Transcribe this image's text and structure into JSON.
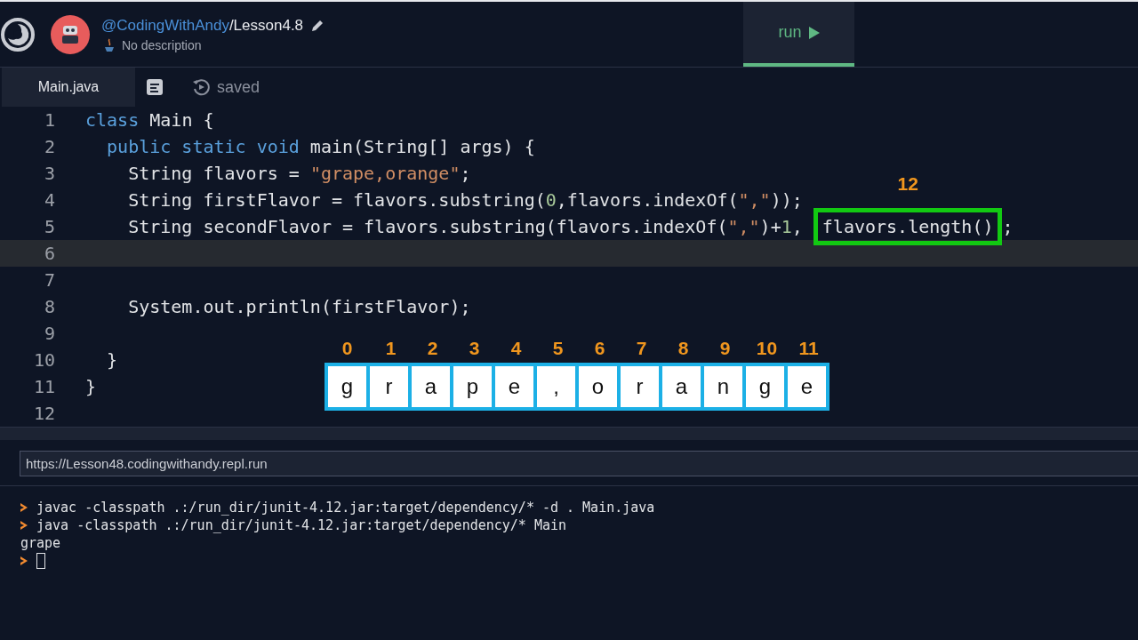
{
  "header": {
    "owner": "@CodingWithAndy",
    "title": "/Lesson4.8",
    "description": "No description"
  },
  "run_button": {
    "label": "run"
  },
  "file_tab": {
    "label": "Main.java",
    "selected": true
  },
  "save_status": "saved",
  "lines": [
    {
      "number": "1",
      "current": false,
      "tokens": [
        {
          "kind": "keyword",
          "text": "class"
        },
        {
          "kind": "plain",
          "text": " Main {"
        }
      ]
    },
    {
      "number": "2",
      "current": false,
      "tokens": [
        {
          "kind": "keyword",
          "text": "  public static void"
        },
        {
          "kind": "plain",
          "text": " main(String[] args) {"
        }
      ]
    },
    {
      "number": "3",
      "current": false,
      "tokens": [
        {
          "kind": "plain",
          "text": "    String flavors = "
        },
        {
          "kind": "string",
          "text": "\"grape,orange\""
        },
        {
          "kind": "plain",
          "text": ";"
        }
      ]
    },
    {
      "number": "4",
      "current": false,
      "tokens": [
        {
          "kind": "plain",
          "text": "    String firstFlavor = flavors.substring("
        },
        {
          "kind": "number",
          "text": "0"
        },
        {
          "kind": "plain",
          "text": ",flavors.indexOf("
        },
        {
          "kind": "string",
          "text": "\",\""
        },
        {
          "kind": "plain",
          "text": "));"
        }
      ]
    },
    {
      "number": "5",
      "current": false,
      "tokens": [
        {
          "kind": "plain",
          "text": "    String secondFlavor = flavors.substring(flavors.indexOf("
        },
        {
          "kind": "string",
          "text": "\",\""
        },
        {
          "kind": "plain",
          "text": ")+"
        },
        {
          "kind": "number",
          "text": "1"
        },
        {
          "kind": "plain",
          "text": ", "
        },
        {
          "kind": "boxed",
          "text": "flavors.length()",
          "callout": "12"
        },
        {
          "kind": "plain",
          "text": ";"
        }
      ]
    },
    {
      "number": "6",
      "current": true
    },
    {
      "number": "7",
      "current": false
    },
    {
      "number": "8",
      "current": false,
      "tokens": [
        {
          "kind": "plain",
          "text": "    System.out.println(firstFlavor);"
        }
      ]
    },
    {
      "number": "9",
      "current": false
    },
    {
      "number": "10",
      "current": false,
      "tokens": [
        {
          "kind": "plain",
          "text": "  }"
        }
      ]
    },
    {
      "number": "11",
      "current": false,
      "tokens": [
        {
          "kind": "plain",
          "text": "}"
        }
      ]
    },
    {
      "number": "12",
      "current": false
    }
  ],
  "index_strip": [
    {
      "index": "0",
      "char": "g"
    },
    {
      "index": "1",
      "char": "r"
    },
    {
      "index": "2",
      "char": "a"
    },
    {
      "index": "3",
      "char": "p"
    },
    {
      "index": "4",
      "char": "e"
    },
    {
      "index": "5",
      "char": ","
    },
    {
      "index": "6",
      "char": "o"
    },
    {
      "index": "7",
      "char": "r"
    },
    {
      "index": "8",
      "char": "a"
    },
    {
      "index": "9",
      "char": "n"
    },
    {
      "index": "10",
      "char": "g"
    },
    {
      "index": "11",
      "char": "e"
    }
  ],
  "url": "https://Lesson48.codingwithandy.repl.run",
  "terminal": [
    {
      "kind": "command",
      "text": "javac -classpath .:/run_dir/junit-4.12.jar:target/dependency/* -d . Main.java"
    },
    {
      "kind": "command",
      "text": "java -classpath .:/run_dir/junit-4.12.jar:target/dependency/* Main"
    },
    {
      "kind": "output",
      "text": "grape"
    },
    {
      "kind": "prompt"
    }
  ]
}
